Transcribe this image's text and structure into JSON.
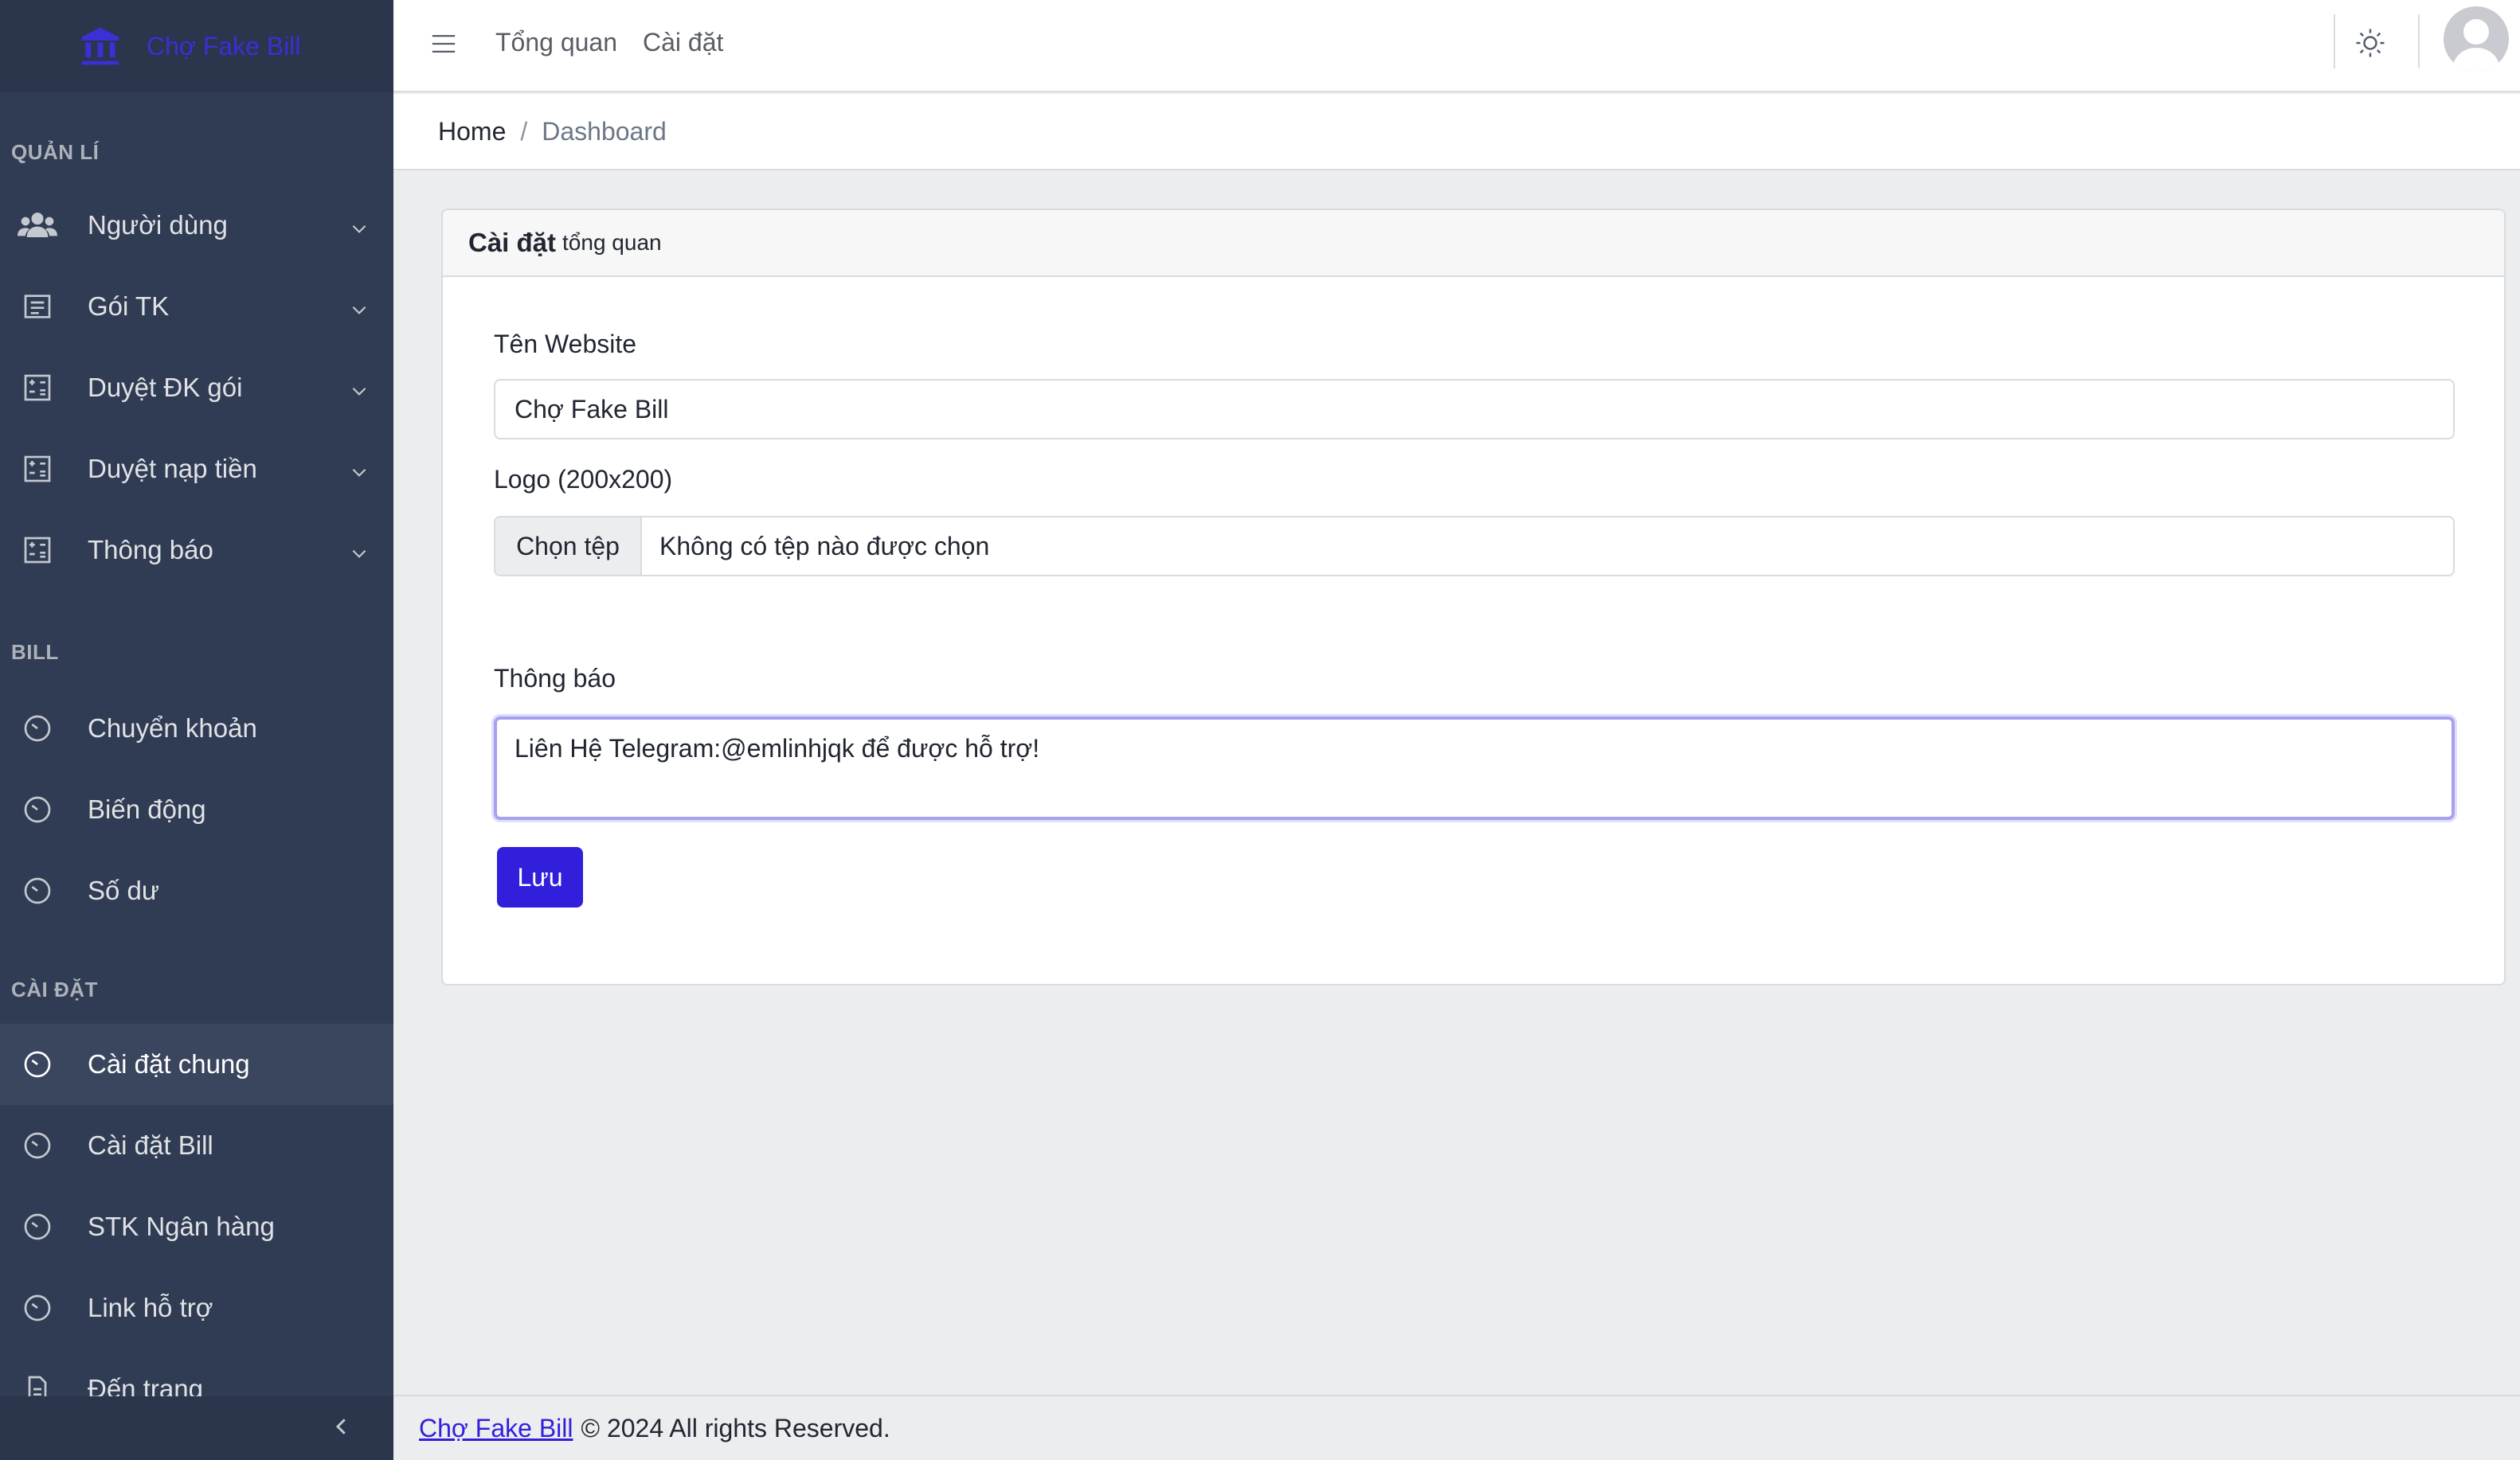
{
  "brand": {
    "name": "Chợ Fake Bill",
    "icon": "bank-icon",
    "color": "#3b2fd6"
  },
  "sidebar": {
    "sections": [
      {
        "title": "QUẢN LÍ"
      },
      {
        "title": "BILL"
      },
      {
        "title": "CÀI ĐẶT"
      }
    ],
    "items": [
      {
        "label": "Người dùng",
        "icon": "users-icon",
        "dropdown": true
      },
      {
        "label": "Gói TK",
        "icon": "list-icon",
        "dropdown": true
      },
      {
        "label": "Duyệt ĐK gói",
        "icon": "calculator-icon",
        "dropdown": true
      },
      {
        "label": "Duyệt nạp tiền",
        "icon": "calculator-icon",
        "dropdown": true
      },
      {
        "label": "Thông báo",
        "icon": "calculator-icon",
        "dropdown": true
      },
      {
        "label": "Chuyển khoản",
        "icon": "speedometer-icon"
      },
      {
        "label": "Biến động",
        "icon": "speedometer-icon"
      },
      {
        "label": "Số dư",
        "icon": "speedometer-icon"
      },
      {
        "label": "Cài đặt chung",
        "icon": "speedometer-icon",
        "active": true
      },
      {
        "label": "Cài đặt Bill",
        "icon": "speedometer-icon"
      },
      {
        "label": "STK Ngân hàng",
        "icon": "speedometer-icon"
      },
      {
        "label": "Link hỗ trợ",
        "icon": "speedometer-icon"
      },
      {
        "label": "Đến trang",
        "icon": "file-icon"
      }
    ]
  },
  "header": {
    "nav": [
      "Tổng quan",
      "Cài đặt"
    ]
  },
  "breadcrumb": {
    "home": "Home",
    "current": "Dashboard"
  },
  "card": {
    "title": "Cài đặt",
    "subtitle": "tổng quan",
    "fields": {
      "website_label": "Tên Website",
      "website_value": "Chợ Fake Bill",
      "logo_label": "Logo (200x200)",
      "file_button": "Chọn tệp",
      "file_status": "Không có tệp nào được chọn",
      "notice_label": "Thông báo",
      "notice_value": "Liên Hệ Telegram:@emlinhjqk để được hỗ trợ!"
    },
    "save_label": "Lưu"
  },
  "footer": {
    "link": "Chợ Fake Bill",
    "text": "© 2024 All rights Reserved."
  },
  "colors": {
    "primary": "#321fdb",
    "sidebar_bg": "#303c54"
  }
}
